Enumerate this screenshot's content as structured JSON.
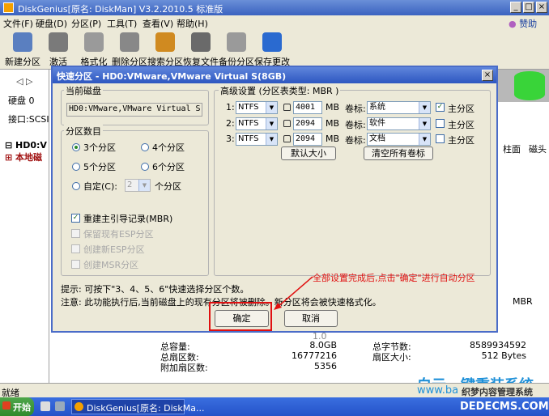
{
  "window": {
    "title": "DiskGenius[原名: DiskMan] V3.2.2010.5 标准版",
    "help": "赞助"
  },
  "menu": [
    "文件(F)",
    "硬盘(D)",
    "分区(P)",
    "工具(T)",
    "查看(V)",
    "帮助(H)"
  ],
  "toolbar": [
    {
      "label": "新建分区",
      "icon": "new-partition-icon",
      "color": "#5a7fc0"
    },
    {
      "label": "激活",
      "icon": "activate-icon",
      "color": "#7a7a7a"
    },
    {
      "label": "格式化",
      "icon": "format-icon",
      "color": "#9a9a9a"
    },
    {
      "label": "删除分区",
      "icon": "delete-partition-icon",
      "color": "#888888"
    },
    {
      "label": "搜索分区",
      "icon": "search-partition-icon",
      "color": "#d08a20"
    },
    {
      "label": "恢复文件",
      "icon": "recover-file-icon",
      "color": "#6a6a6a"
    },
    {
      "label": "备份分区",
      "icon": "backup-partition-icon",
      "color": "#9a9a9a"
    },
    {
      "label": "保存更改",
      "icon": "save-changes-icon",
      "color": "#2a6ad0"
    }
  ],
  "leftpane": {
    "disk": "硬盘 0",
    "iface": "接口:SCSI",
    "tree1": "HD0:V",
    "tree2": "本地磁"
  },
  "bgright": {
    "col1": "柱面",
    "col2": "磁头",
    "mbr": "MBR"
  },
  "bginfo": {
    "rows": [
      {
        "k": "总容量:",
        "v": "8.0GB",
        "k2": "总字节数:",
        "v2": "8589934592"
      },
      {
        "k": "总扇区数:",
        "v": "16777216",
        "k2": "扇区大小:",
        "v2": "512 Bytes"
      },
      {
        "k": "附加扇区数:",
        "v": "5356",
        "k2": "",
        "v2": ""
      }
    ],
    "partial": "1.0"
  },
  "status": "就绪",
  "taskbar": {
    "start": "开始",
    "item": "DiskGenius[原名: DiskMa..."
  },
  "watermark": {
    "line1": "白云一键重装系统",
    "line2": "www.ba",
    "line3": "织梦内容管理系统",
    "line4": "DEDECMS.COM"
  },
  "dialog": {
    "title": "快速分区 - HD0:VMware,VMware Virtual S(8GB)",
    "current_disk_label": "当前磁盘",
    "current_disk_value": "HD0:VMware,VMware Virtual S",
    "partition_count_label": "分区数目",
    "radios": [
      "3个分区",
      "4个分区",
      "5个分区",
      "6个分区"
    ],
    "custom_label": "自定(C):",
    "custom_value": "2",
    "custom_suffix": "个分区",
    "checks": [
      {
        "label": "重建主引导记录(MBR)",
        "checked": true,
        "disabled": false
      },
      {
        "label": "保留现有ESP分区",
        "checked": false,
        "disabled": true
      },
      {
        "label": "创建新ESP分区",
        "checked": false,
        "disabled": true
      },
      {
        "label": "创建MSR分区",
        "checked": false,
        "disabled": true
      }
    ],
    "adv_label": "高级设置 (分区表类型: MBR )",
    "unit": "MB",
    "vol_label": "卷标:",
    "primary_label": "主分区",
    "partitions": [
      {
        "idx": "1:",
        "fs": "NTFS",
        "size": "4001",
        "vol": "系统",
        "primary": true
      },
      {
        "idx": "2:",
        "fs": "NTFS",
        "size": "2094",
        "vol": "软件",
        "primary": false
      },
      {
        "idx": "3:",
        "fs": "NTFS",
        "size": "2094",
        "vol": "文档",
        "primary": false
      }
    ],
    "default_size_btn": "默认大小",
    "clear_labels_btn": "清空所有卷标",
    "hint1": "提示: 可按下\"3、4、5、6\"快速选择分区个数。",
    "hint2": "注意: 此功能执行后,当前磁盘上的现有分区将被删除。新分区将会被快速格式化。",
    "ok": "确定",
    "cancel": "取消"
  },
  "annotation": {
    "text": "全部设置完成后,点击\"确定\"进行自动分区",
    "color": "#e01010"
  }
}
